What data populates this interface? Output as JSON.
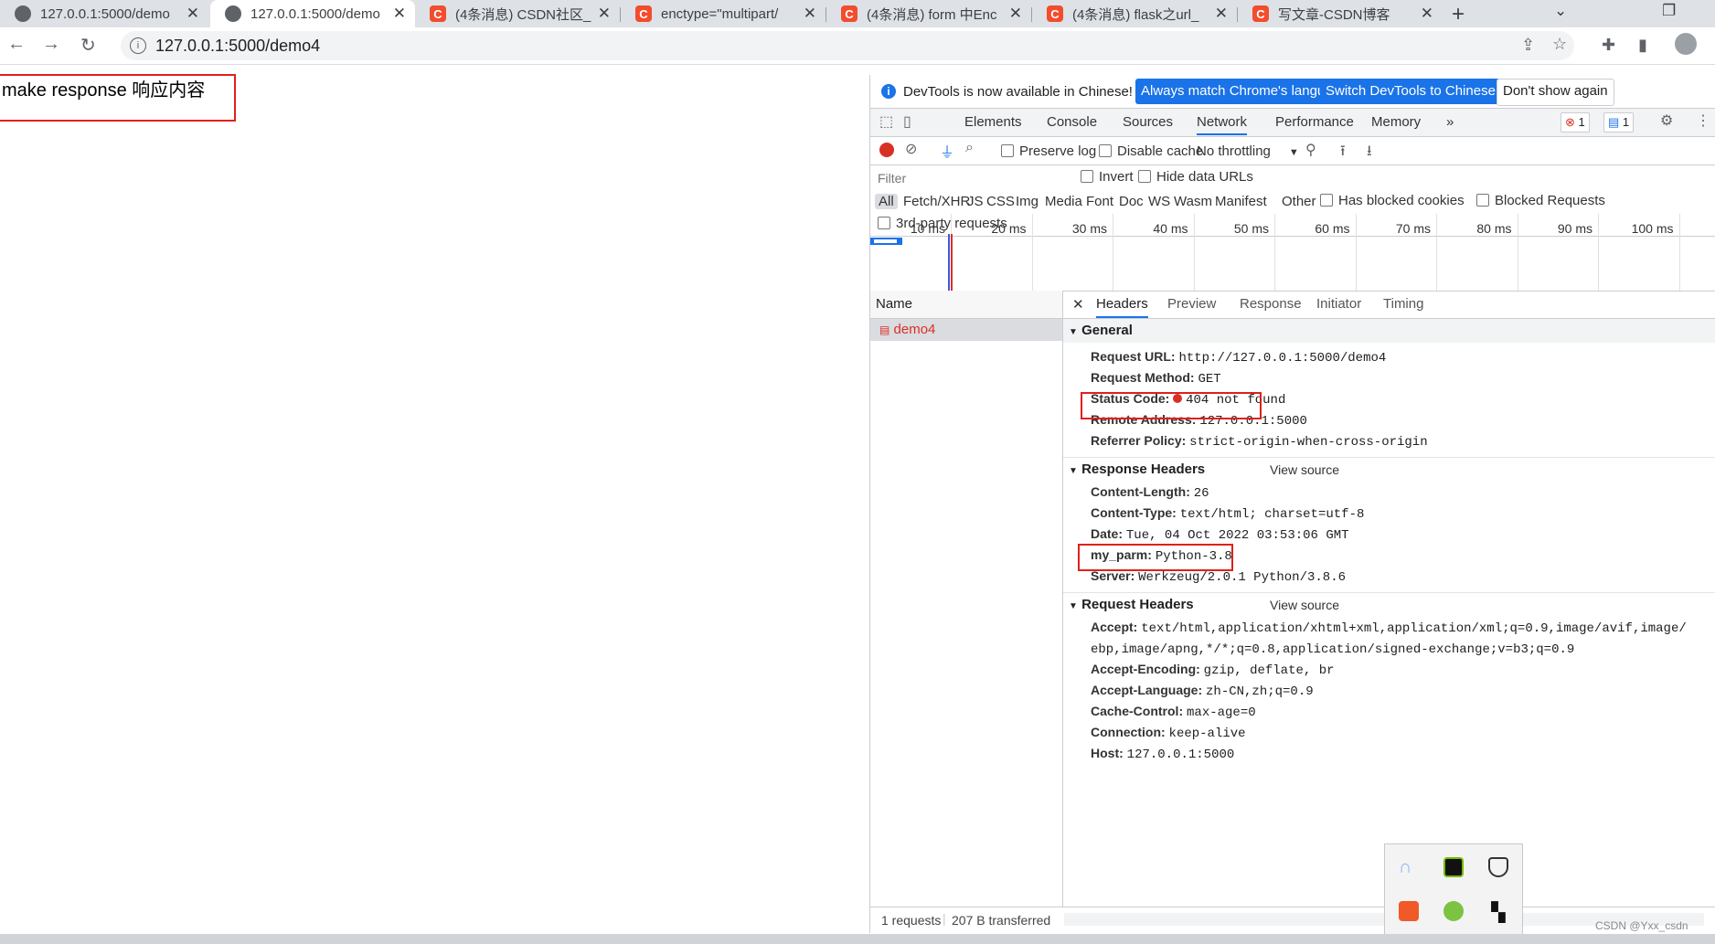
{
  "tabs": [
    {
      "title": "127.0.0.1:5000/demo",
      "icon": "globe-icon",
      "active": false
    },
    {
      "title": "127.0.0.1:5000/demo",
      "icon": "globe-icon",
      "active": true
    },
    {
      "title": "(4条消息) CSDN社区_",
      "icon": "csdn-icon",
      "active": false
    },
    {
      "title": "enctype=\"multipart/",
      "icon": "csdn-icon",
      "active": false
    },
    {
      "title": "(4条消息) form 中Enc",
      "icon": "csdn-icon",
      "active": false
    },
    {
      "title": "(4条消息) flask之url_",
      "icon": "csdn-icon",
      "active": false
    },
    {
      "title": "写文章-CSDN博客",
      "icon": "csdn-icon",
      "active": false
    }
  ],
  "address": {
    "url": "127.0.0.1:5000/demo4"
  },
  "page": {
    "text": "make response 响应内容"
  },
  "devtools": {
    "infobar": {
      "message": "DevTools is now available in Chinese!",
      "btn_match": "Always match Chrome's language",
      "btn_switch": "Switch DevTools to Chinese",
      "btn_dismiss": "Don't show again"
    },
    "panels": [
      "Elements",
      "Console",
      "Sources",
      "Network",
      "Performance",
      "Memory"
    ],
    "active_panel": "Network",
    "errors_count": "1",
    "messages_count": "1",
    "network_toolbar": {
      "preserve_log": "Preserve log",
      "disable_cache": "Disable cache",
      "throttling": "No throttling"
    },
    "filter": {
      "placeholder": "Filter",
      "invert": "Invert",
      "hide_data_urls": "Hide data URLs"
    },
    "types": [
      "All",
      "Fetch/XHR",
      "JS",
      "CSS",
      "Img",
      "Media",
      "Font",
      "Doc",
      "WS",
      "Wasm",
      "Manifest",
      "Other"
    ],
    "has_blocked_cookies": "Has blocked cookies",
    "blocked_requests": "Blocked Requests",
    "third_party": "3rd-party requests",
    "timeline_ticks": [
      "10 ms",
      "20 ms",
      "30 ms",
      "40 ms",
      "50 ms",
      "60 ms",
      "70 ms",
      "80 ms",
      "90 ms",
      "100 ms"
    ],
    "name_header": "Name",
    "request_name": "demo4",
    "footer": {
      "requests": "1 requests",
      "transferred": "207 B transferred"
    },
    "detail_tabs": [
      "Headers",
      "Preview",
      "Response",
      "Initiator",
      "Timing"
    ],
    "general": {
      "title": "General",
      "rows": [
        {
          "k": "Request URL:",
          "v": "http://127.0.0.1:5000/demo4"
        },
        {
          "k": "Request Method:",
          "v": "GET"
        },
        {
          "k": "Status Code:",
          "v": "404 not found"
        },
        {
          "k": "Remote Address:",
          "v": "127.0.0.1:5000"
        },
        {
          "k": "Referrer Policy:",
          "v": "strict-origin-when-cross-origin"
        }
      ]
    },
    "response_headers": {
      "title": "Response Headers",
      "view_source": "View source",
      "rows": [
        {
          "k": "Content-Length:",
          "v": "26"
        },
        {
          "k": "Content-Type:",
          "v": "text/html; charset=utf-8"
        },
        {
          "k": "Date:",
          "v": "Tue, 04 Oct 2022 03:53:06 GMT"
        },
        {
          "k": "my_parm:",
          "v": "Python-3.8"
        },
        {
          "k": "Server:",
          "v": "Werkzeug/2.0.1 Python/3.8.6"
        }
      ]
    },
    "request_headers": {
      "title": "Request Headers",
      "view_source": "View source",
      "rows": [
        {
          "k": "Accept:",
          "v": "text/html,application/xhtml+xml,application/xml;q=0.9,image/avif,image/"
        },
        {
          "k": "",
          "v": "ebp,image/apng,*/*;q=0.8,application/signed-exchange;v=b3;q=0.9"
        },
        {
          "k": "Accept-Encoding:",
          "v": "gzip, deflate, br"
        },
        {
          "k": "Accept-Language:",
          "v": "zh-CN,zh;q=0.9"
        },
        {
          "k": "Cache-Control:",
          "v": "max-age=0"
        },
        {
          "k": "Connection:",
          "v": "keep-alive"
        },
        {
          "k": "Host:",
          "v": "127.0.0.1:5000"
        }
      ]
    }
  },
  "watermark": "CSDN @Yxx_csdn",
  "colors": {
    "accent": "#1a73e8",
    "error": "#d93025",
    "highlight": "#e0201b"
  }
}
